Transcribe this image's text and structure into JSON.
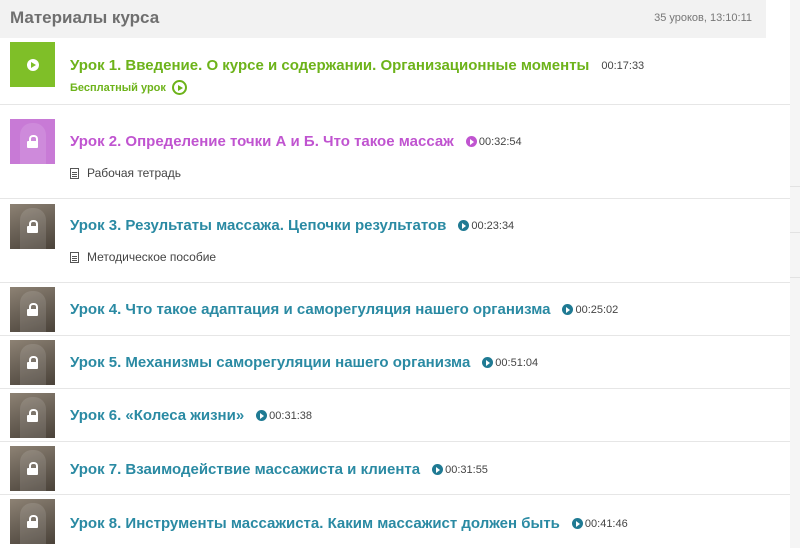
{
  "header": {
    "title": "Материалы курса",
    "meta": "35 уроков, 13:10:11"
  },
  "lessons": [
    {
      "title": "Урок 1. Введение. О курсе и содержании. Организационные моменты",
      "duration": "00:17:33",
      "free_label": "Бесплатный урок",
      "thumb_icon": "play-icon",
      "color": "#6db31a"
    },
    {
      "title": "Урок 2. Определение точки А и Б. Что такое массаж",
      "duration": "00:32:54",
      "material": "Рабочая тетрадь",
      "thumb_icon": "lock-icon",
      "color": "#c054d0"
    },
    {
      "title": "Урок 3. Результаты массажа. Цепочки результатов",
      "duration": "00:23:34",
      "material": "Методическое пособие",
      "thumb_icon": "lock-icon",
      "color": "#2a8aa3"
    },
    {
      "title": "Урок 4. Что такое адаптация и саморегуляция нашего организма",
      "duration": "00:25:02",
      "thumb_icon": "lock-icon",
      "color": "#2a8aa3"
    },
    {
      "title": "Урок 5. Механизмы саморегуляции нашего организма",
      "duration": "00:51:04",
      "thumb_icon": "lock-icon",
      "color": "#2a8aa3"
    },
    {
      "title": "Урок 6. «Колеса жизни»",
      "duration": "00:31:38",
      "thumb_icon": "lock-icon",
      "color": "#2a8aa3"
    },
    {
      "title": "Урок 7. Взаимодействие массажиста и клиента",
      "duration": "00:31:55",
      "thumb_icon": "lock-icon",
      "color": "#2a8aa3"
    },
    {
      "title": "Урок 8. Инструменты массажиста. Каким массажист должен быть",
      "duration": "00:41:46",
      "thumb_icon": "lock-icon",
      "color": "#2a8aa3"
    }
  ]
}
